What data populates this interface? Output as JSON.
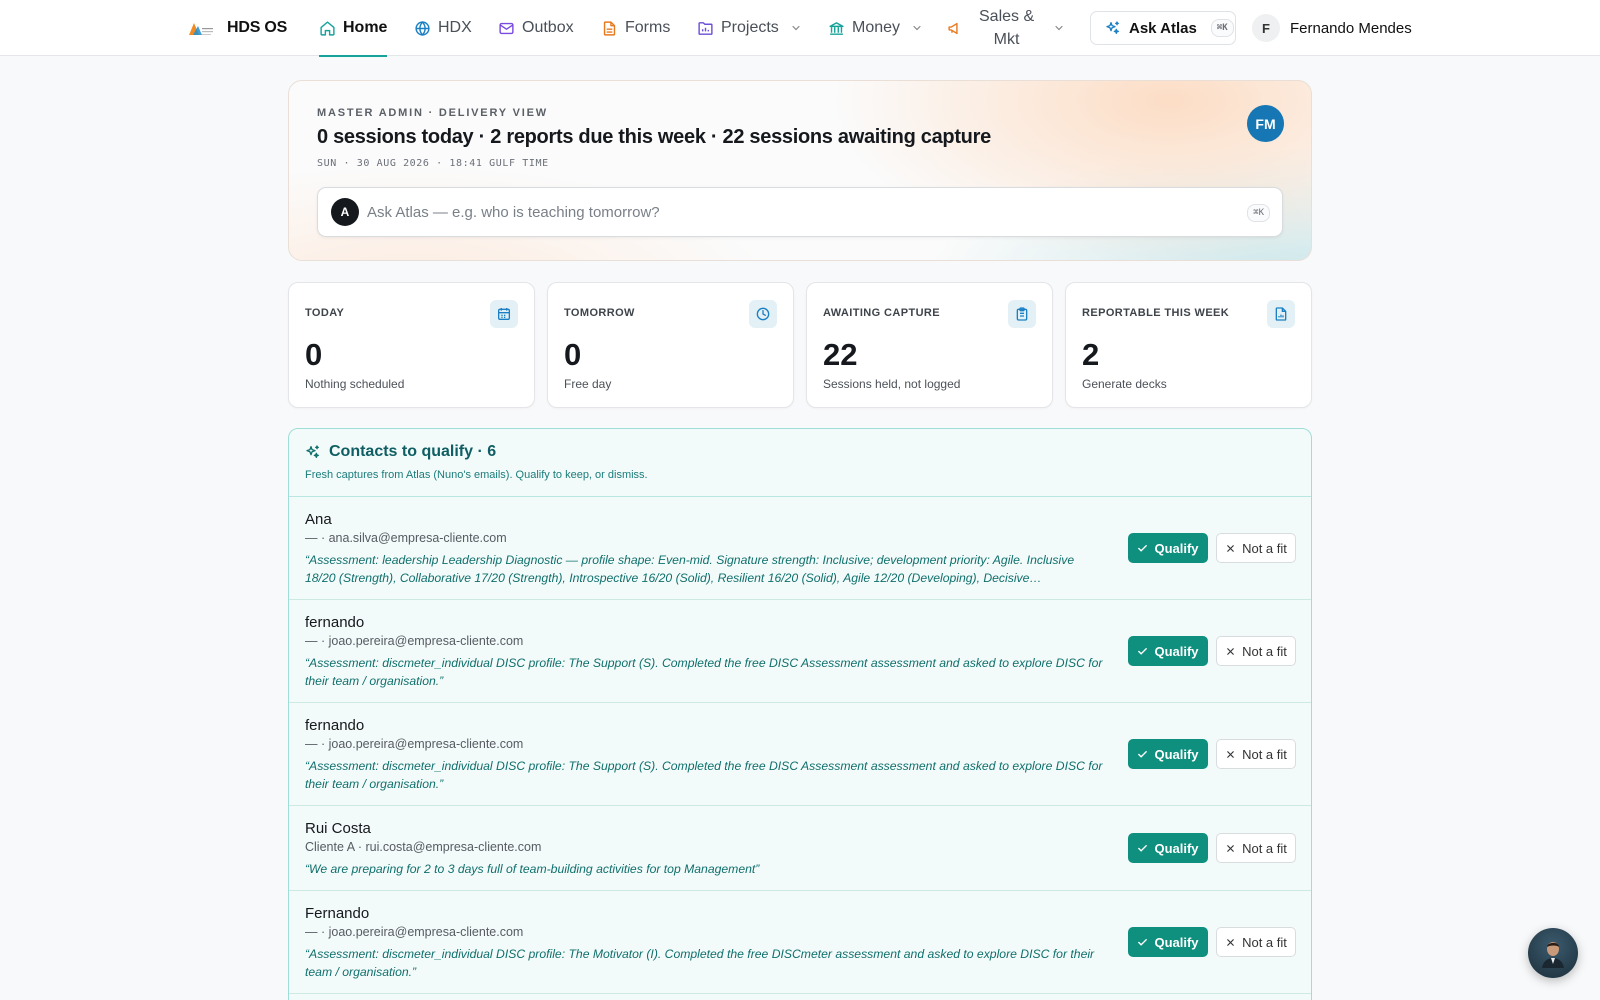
{
  "brand": {
    "name": "HDS OS"
  },
  "nav": {
    "items": [
      {
        "label": "Home",
        "icon": "home-icon"
      },
      {
        "label": "HDX",
        "icon": "globe-icon"
      },
      {
        "label": "Outbox",
        "icon": "mail-icon"
      },
      {
        "label": "Forms",
        "icon": "file-text-icon"
      },
      {
        "label": "Projects",
        "icon": "folder-chart-icon"
      },
      {
        "label": "Money",
        "icon": "bank-icon"
      },
      {
        "label_line1": "Sales &",
        "label_line2": "Mkt",
        "icon": "megaphone-icon"
      }
    ],
    "ask_label": "Ask Atlas",
    "ask_shortcut": "⌘K",
    "user_initial": "F",
    "user_name": "Fernando Mendes"
  },
  "hero": {
    "eyebrow": "MASTER ADMIN · DELIVERY VIEW",
    "title": "0 sessions today · 2 reports due this week · 22 sessions awaiting capture",
    "date": "SUN · 30 AUG 2026 · 18:41 GULF TIME",
    "avatar_initials": "FM",
    "search_badge": "A",
    "search_placeholder": "Ask Atlas — e.g. who is teaching tomorrow?",
    "search_shortcut": "⌘K"
  },
  "stats": [
    {
      "label": "TODAY",
      "value": "0",
      "sub": "Nothing scheduled",
      "icon": "calendar-icon"
    },
    {
      "label": "TOMORROW",
      "value": "0",
      "sub": "Free day",
      "icon": "clock-icon"
    },
    {
      "label": "AWAITING CAPTURE",
      "value": "22",
      "sub": "Sessions held, not logged",
      "icon": "clipboard-icon"
    },
    {
      "label": "REPORTABLE THIS WEEK",
      "value": "2",
      "sub": "Generate decks",
      "icon": "report-file-icon"
    }
  ],
  "contacts": {
    "title": "Contacts to qualify · 6",
    "subtitle": "Fresh captures from Atlas (Nuno's emails). Qualify to keep, or dismiss.",
    "qualify_label": "Qualify",
    "not_fit_label": "Not a fit",
    "rows": [
      {
        "name": "Ana",
        "meta": "— · ana.silva@empresa-cliente.com",
        "quote": "“Assessment: leadership Leadership Diagnostic — profile shape: Even-mid. Signature strength: Inclusive; development priority: Agile. Inclusive 18/20 (Strength), Collaborative 17/20 (Strength), Introspective 16/20 (Solid), Resilient 16/20 (Solid), Agile 12/20 (Developing), Decisive…"
      },
      {
        "name": "fernando",
        "meta": "— · joao.pereira@empresa-cliente.com",
        "quote": "“Assessment: discmeter_individual DISC profile: The Support (S). Completed the free DISC Assessment assessment and asked to explore DISC for their team / organisation.”"
      },
      {
        "name": "fernando",
        "meta": "— · joao.pereira@empresa-cliente.com",
        "quote": "“Assessment: discmeter_individual DISC profile: The Support (S). Completed the free DISC Assessment assessment and asked to explore DISC for their team / organisation.”"
      },
      {
        "name": "Rui Costa",
        "meta": "Cliente A · rui.costa@empresa-cliente.com",
        "quote": "“We are preparing for 2 to 3 days full of team-building activities for top Management”"
      },
      {
        "name": "Fernando",
        "meta": "— · joao.pereira@empresa-cliente.com",
        "quote": "“Assessment: discmeter_individual DISC profile: The Motivator (I). Completed the free DISCmeter assessment and asked to explore DISC for their team / organisation.”"
      }
    ]
  },
  "colors": {
    "accent": "#15a39a",
    "qualify": "#0f8f7e",
    "avatar": "#1677b4",
    "teal_text": "#0f6f6c"
  }
}
